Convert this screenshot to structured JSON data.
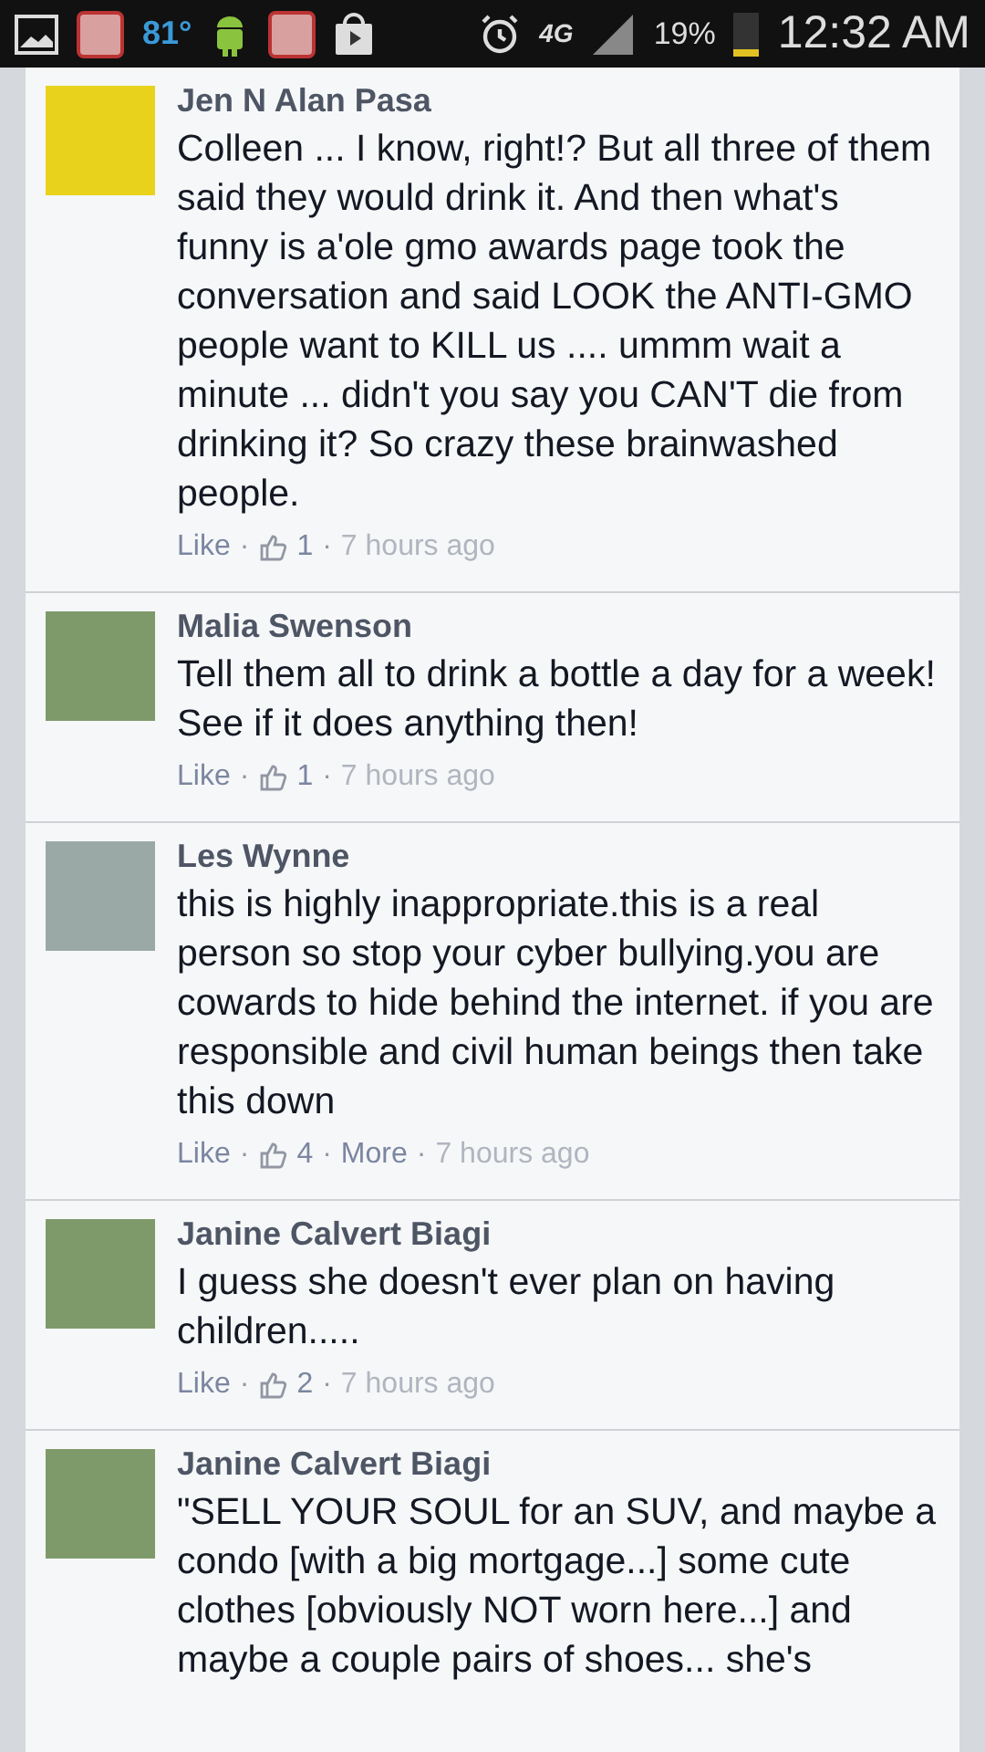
{
  "status_bar": {
    "temperature": "81°",
    "network": "4G",
    "battery": "19%",
    "time": "12:32 AM"
  },
  "comments": [
    {
      "author": "Jen N Alan Pasa",
      "text": "Colleen ... I know, right!? But all three of them said they would drink it. And then what's funny is a'ole gmo awards page took the conversation and said LOOK the ANTI-GMO people want to KILL us .... ummm wait a minute ... didn't you say you CAN'T die from drinking it? So crazy these brainwashed people.",
      "footer": [
        {
          "kind": "link",
          "text": "Like"
        },
        {
          "kind": "dot",
          "text": "·"
        },
        {
          "kind": "likes",
          "text": "1"
        },
        {
          "kind": "dot",
          "text": "·"
        },
        {
          "kind": "time",
          "text": "7 hours ago"
        }
      ]
    },
    {
      "author": "Malia Swenson",
      "text": "Tell them all to drink a bottle a day for a week! See if it does anything then!",
      "footer": [
        {
          "kind": "link",
          "text": "Like"
        },
        {
          "kind": "dot",
          "text": "·"
        },
        {
          "kind": "likes",
          "text": "1"
        },
        {
          "kind": "dot",
          "text": "·"
        },
        {
          "kind": "time",
          "text": "7 hours ago"
        }
      ]
    },
    {
      "author": "Les Wynne",
      "text": "this is highly inappropriate.this is a real person so stop your cyber bullying.you are cowards to hide behind the internet. if you are responsible and civil human beings then take this down",
      "footer": [
        {
          "kind": "link",
          "text": "Like"
        },
        {
          "kind": "dot",
          "text": "·"
        },
        {
          "kind": "likes",
          "text": "4"
        },
        {
          "kind": "dot",
          "text": "·"
        },
        {
          "kind": "link",
          "text": "More"
        },
        {
          "kind": "dot",
          "text": "·"
        },
        {
          "kind": "time",
          "text": "7 hours ago"
        }
      ]
    },
    {
      "author": "Janine Calvert Biagi",
      "text": "I guess she doesn't ever plan on having children.....",
      "footer": [
        {
          "kind": "link",
          "text": "Like"
        },
        {
          "kind": "dot",
          "text": "·"
        },
        {
          "kind": "likes",
          "text": "2"
        },
        {
          "kind": "dot",
          "text": "·"
        },
        {
          "kind": "time",
          "text": "7 hours ago"
        }
      ]
    },
    {
      "author": "Janine Calvert Biagi",
      "text": "\"SELL YOUR SOUL for an SUV, and maybe a condo [with a big mortgage...] some cute clothes [obviously NOT worn here...] and maybe a couple pairs of shoes... she's"
    }
  ]
}
